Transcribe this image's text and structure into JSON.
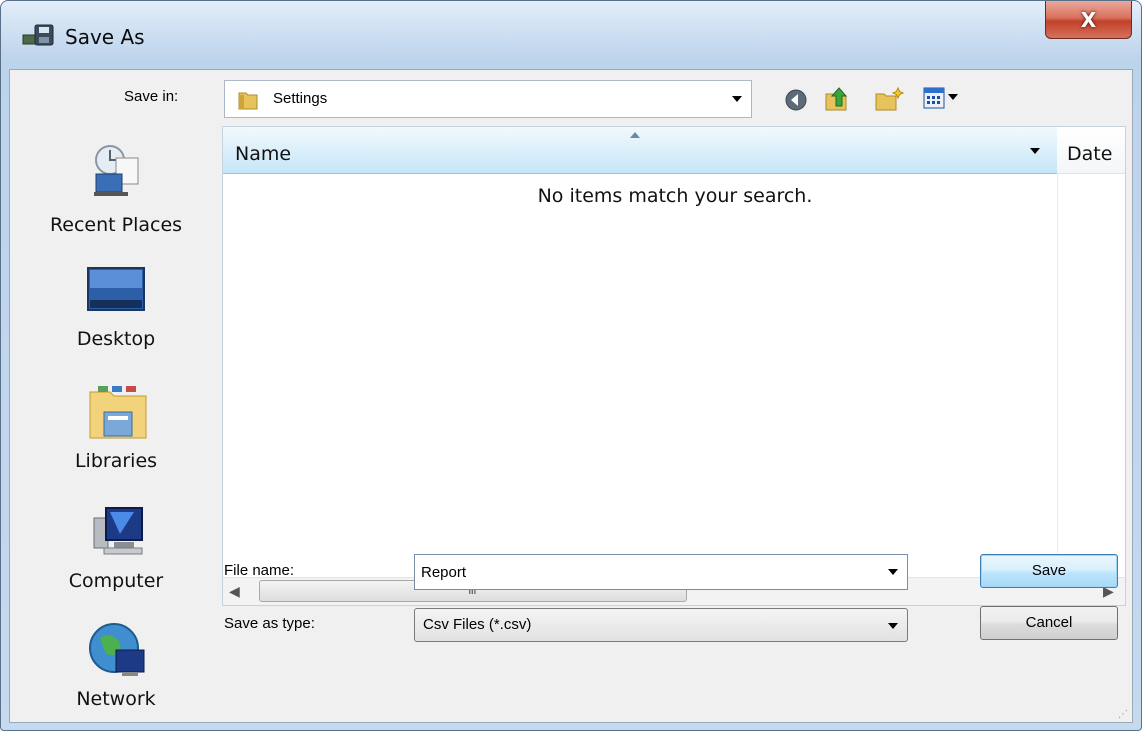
{
  "window": {
    "title": "Save As",
    "close_label": "X"
  },
  "toolbar": {
    "save_in_label": "Save in:",
    "save_in_value": "Settings"
  },
  "places": [
    {
      "label": "Recent Places",
      "icon": "recent-places-icon"
    },
    {
      "label": "Desktop",
      "icon": "desktop-icon"
    },
    {
      "label": "Libraries",
      "icon": "libraries-icon"
    },
    {
      "label": "Computer",
      "icon": "computer-icon"
    },
    {
      "label": "Network",
      "icon": "network-icon"
    }
  ],
  "list": {
    "columns": [
      "Name",
      "Date"
    ],
    "empty_message": "No items match your search.",
    "scroll_grip": "III"
  },
  "form": {
    "file_name_label": "File name:",
    "file_name_value": "Report",
    "save_type_label": "Save as type:",
    "save_type_value": "Csv Files (*.csv)"
  },
  "buttons": {
    "save": "Save",
    "cancel": "Cancel"
  },
  "colors": {
    "close_button": "#c2412a",
    "header_blue": "#c5e6f8",
    "default_button_border": "#3c7fb1"
  }
}
